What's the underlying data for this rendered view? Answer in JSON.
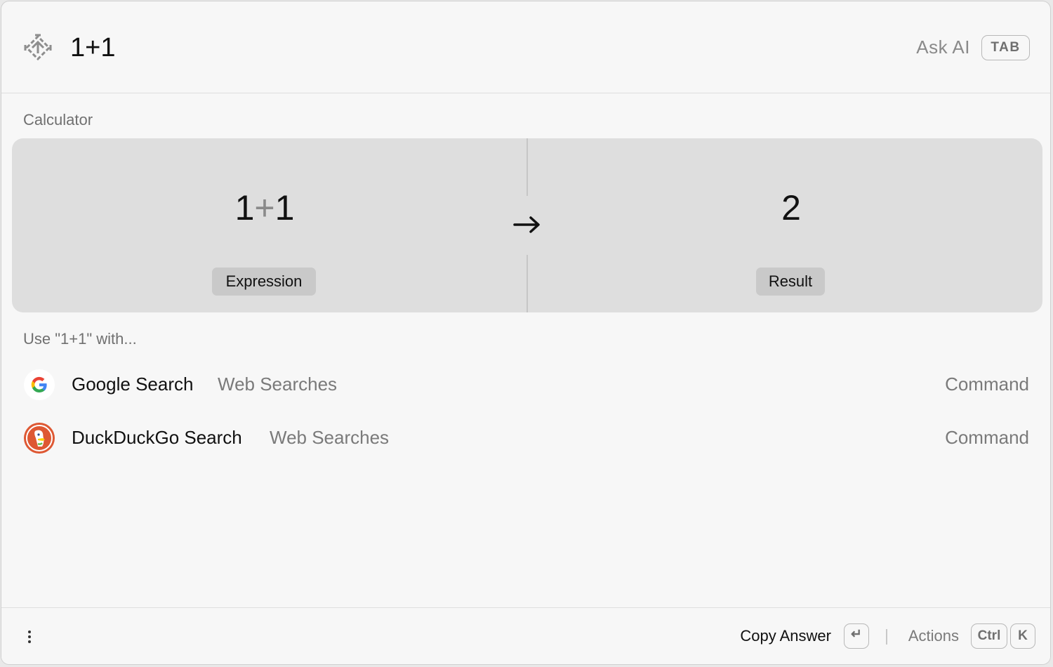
{
  "search": {
    "value": "1+1",
    "ask_ai_label": "Ask AI",
    "ask_ai_key": "TAB"
  },
  "calculator": {
    "section_title": "Calculator",
    "expression": {
      "left": "1",
      "operator": "+",
      "right": "1",
      "label": "Expression"
    },
    "result": {
      "value": "2",
      "label": "Result"
    }
  },
  "fallback": {
    "section_title": "Use \"1+1\" with...",
    "items": [
      {
        "title": "Google Search",
        "subtitle": "Web Searches",
        "accessory": "Command",
        "icon": "google-icon"
      },
      {
        "title": "DuckDuckGo Search",
        "subtitle": "Web Searches",
        "accessory": "Command",
        "icon": "duckduckgo-icon"
      }
    ]
  },
  "footer": {
    "primary_action": "Copy Answer",
    "primary_key": "↵",
    "actions_label": "Actions",
    "actions_keys": [
      "Ctrl",
      "K"
    ]
  },
  "colors": {
    "window_bg": "#f7f7f7",
    "card_bg": "#dedede",
    "label_bg": "#c9c9c9",
    "muted_text": "#7a7a7a",
    "primary_text": "#111111"
  }
}
